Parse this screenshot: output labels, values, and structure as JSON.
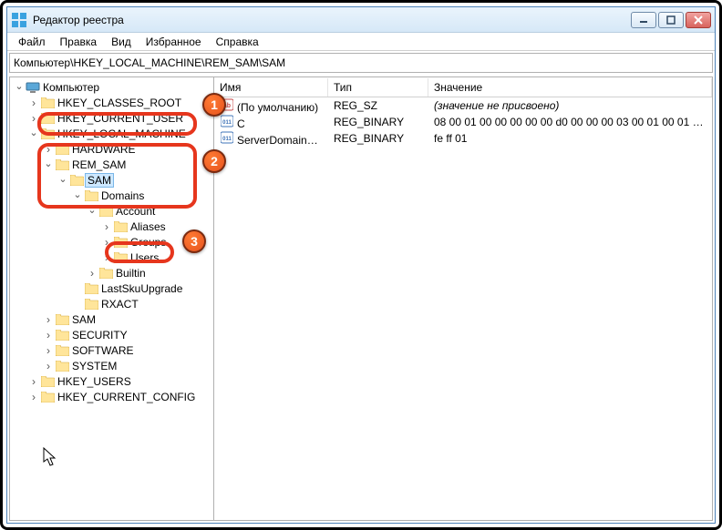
{
  "app": {
    "title": "Редактор реестра"
  },
  "menu": [
    "Файл",
    "Правка",
    "Вид",
    "Избранное",
    "Справка"
  ],
  "address": "Компьютер\\HKEY_LOCAL_MACHINE\\REM_SAM\\SAM",
  "tree": {
    "root": "Компьютер",
    "nodes": [
      {
        "label": "HKEY_CLASSES_ROOT",
        "exp": "closed",
        "depth": 1
      },
      {
        "label": "HKEY_CURRENT_USER",
        "exp": "closed",
        "depth": 1
      },
      {
        "label": "HKEY_LOCAL_MACHINE",
        "exp": "open",
        "depth": 1
      },
      {
        "label": "HARDWARE",
        "exp": "closed",
        "depth": 2
      },
      {
        "label": "REM_SAM",
        "exp": "open",
        "depth": 2
      },
      {
        "label": "SAM",
        "exp": "open",
        "depth": 3,
        "selected": true
      },
      {
        "label": "Domains",
        "exp": "open",
        "depth": 4
      },
      {
        "label": "Account",
        "exp": "open",
        "depth": 5
      },
      {
        "label": "Aliases",
        "exp": "closed",
        "depth": 6
      },
      {
        "label": "Groups",
        "exp": "closed",
        "depth": 6
      },
      {
        "label": "Users",
        "exp": "closed",
        "depth": 6
      },
      {
        "label": "Builtin",
        "exp": "closed",
        "depth": 5
      },
      {
        "label": "LastSkuUpgrade",
        "exp": "none",
        "depth": 4
      },
      {
        "label": "RXACT",
        "exp": "none",
        "depth": 4
      },
      {
        "label": "SAM",
        "exp": "closed",
        "depth": 2
      },
      {
        "label": "SECURITY",
        "exp": "closed",
        "depth": 2
      },
      {
        "label": "SOFTWARE",
        "exp": "closed",
        "depth": 2
      },
      {
        "label": "SYSTEM",
        "exp": "closed",
        "depth": 2
      },
      {
        "label": "HKEY_USERS",
        "exp": "closed",
        "depth": 1
      },
      {
        "label": "HKEY_CURRENT_CONFIG",
        "exp": "closed",
        "depth": 1
      }
    ]
  },
  "list": {
    "columns": {
      "name": "Имя",
      "type": "Тип",
      "value": "Значение"
    },
    "rows": [
      {
        "icon": "str",
        "name": "(По умолчанию)",
        "type": "REG_SZ",
        "value": "(значение не присвоено)",
        "name_italic": false,
        "value_italic": true
      },
      {
        "icon": "bin",
        "name": "C",
        "type": "REG_BINARY",
        "value": "08 00 01 00 00 00 00 00 d0 00 00 00 03 00 01 00 01 0..."
      },
      {
        "icon": "bin",
        "name": "ServerDomainU...",
        "type": "REG_BINARY",
        "value": "fe ff 01"
      }
    ]
  },
  "callouts": {
    "b1": "1",
    "b2": "2",
    "b3": "3"
  }
}
